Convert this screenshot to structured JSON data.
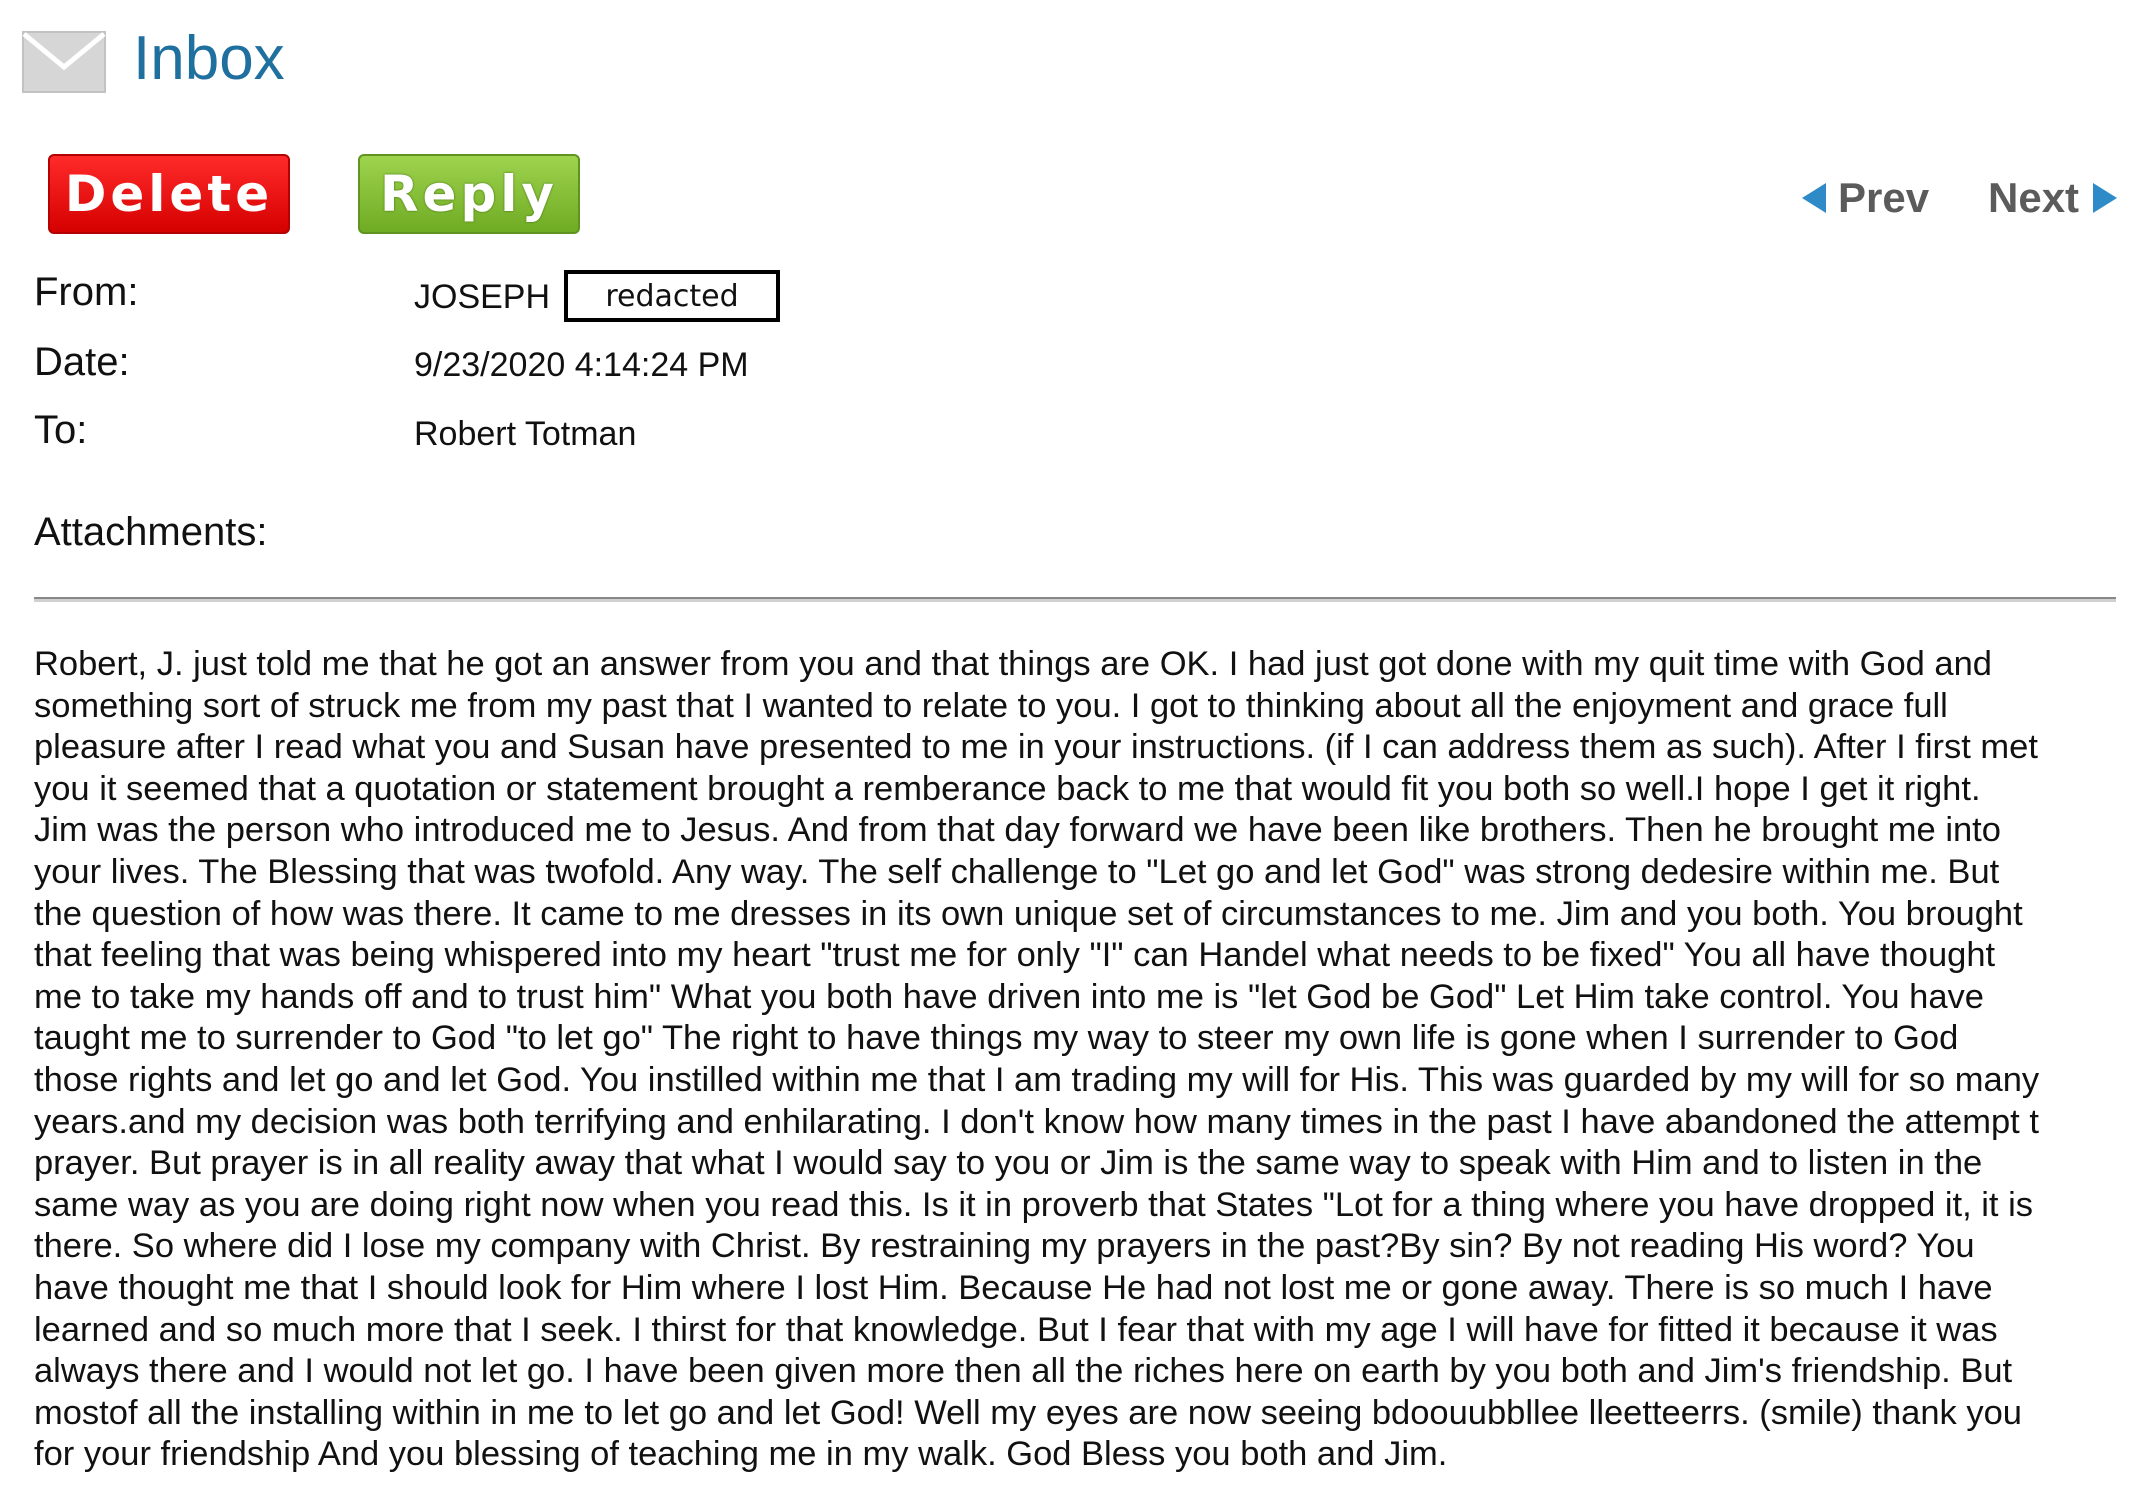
{
  "header": {
    "title": "Inbox",
    "icon": "envelope-icon"
  },
  "toolbar": {
    "delete_label": "Delete",
    "reply_label": "Reply",
    "prev_label": "Prev",
    "next_label": "Next"
  },
  "colors": {
    "delete": "#e30000",
    "reply": "#82bf34",
    "title": "#1f6f9f",
    "arrow": "#2e8bc8"
  },
  "message": {
    "from_label": "From:",
    "from_value": "JOSEPH",
    "redacted_label": "redacted",
    "date_label": "Date:",
    "date_value": "9/23/2020 4:14:24 PM",
    "to_label": "To:",
    "to_value": "Robert Totman",
    "attachments_label": "Attachments:"
  },
  "body_lines": [
    "Robert, J. just told me that he got an answer from you and that things are OK. I had just got done with my quit time with God and",
    "something sort of struck me from my past that I wanted to relate to you. I got to thinking about all the enjoyment and grace full",
    "pleasure after I read what you and Susan have presented to me in your instructions. (if I can address them as such). After I first met",
    "you it seemed that a quotation or statement brought a remberance back to me that would fit you both so well.I hope I get it right.",
    "Jim was the person who introduced me to Jesus. And from that day forward we have been like brothers. Then he brought me into",
    "your lives. The Blessing that was twofold. Any way. The self challenge to \"Let go and let God\" was strong dedesire within me. But",
    "the question of how was there. It came to me dresses in its own unique set of circumstances to me. Jim and you both. You brought",
    "that feeling that was being whispered into my heart \"trust me for only \"I\" can Handel what needs to be fixed\" You all have thought",
    "me to take my hands off and to trust him\" What you both have driven into me is \"let God be God\" Let Him take control. You have",
    "taught me to surrender to God \"to let go\" The right to have things my way to steer my own life is gone when I surrender to God",
    "those rights and let go and let God. You instilled within me that I am trading my will for His. This was guarded by my will for so many",
    "years.and my decision was both terrifying and enhilarating. I don't know how many times in the past I have abandoned the attempt t",
    "prayer. But prayer is in all reality away that what I would say to you or Jim is the same way to speak with Him and to listen in the",
    "same way as you are doing right now when you read this. Is it in proverb that States \"Lot for a thing where you have dropped it, it is",
    "there. So where did I lose my company with Christ. By restraining my prayers in the past?By sin? By not reading His word? You",
    "have thought me that I should look for Him where I lost Him. Because He had not lost me or gone away. There is so much I have",
    "learned and so much more that I seek. I thirst for that knowledge. But I fear that with my age I will have for fitted it because it was",
    "always there and I would not let go. I have been given more then all the riches here on earth by you both and Jim's friendship. But",
    "mostof all the installing within in me to let go and let God! Well my eyes are now seeing bdoouubbllee lleetteerrs. (smile) thank you",
    "for your friendship And you blessing of teaching me in my walk. God Bless you both and Jim."
  ]
}
